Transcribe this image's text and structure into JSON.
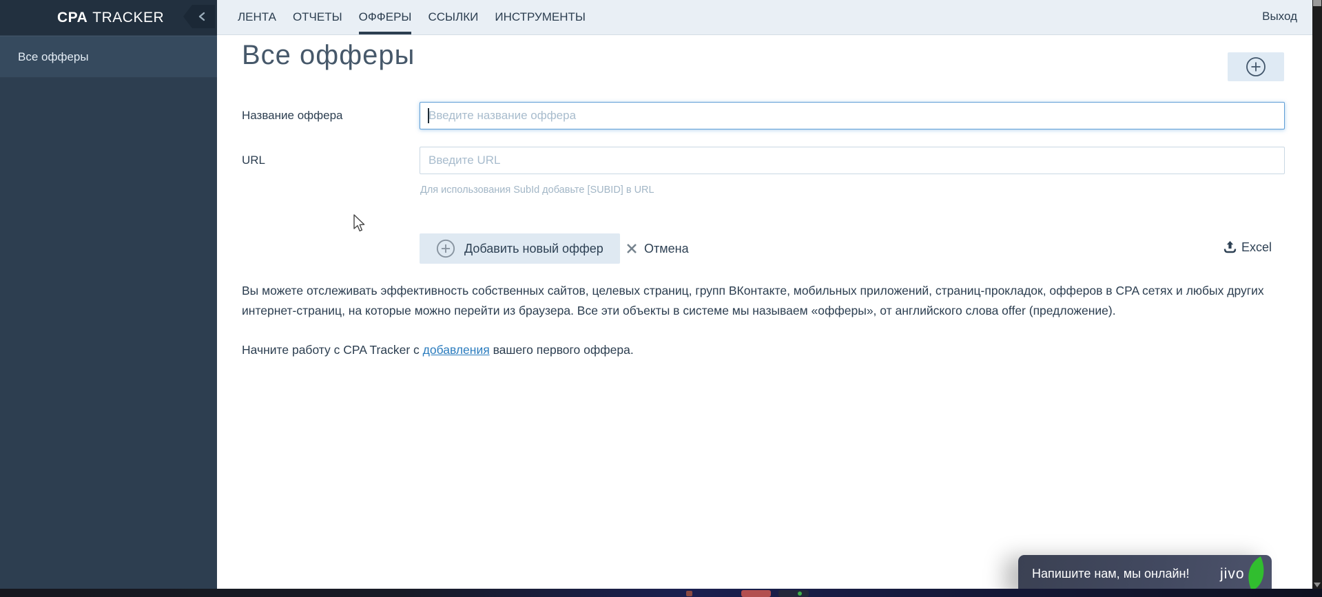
{
  "app": {
    "brand_bold": "CPA",
    "brand_rest": "TRACKER"
  },
  "sidebar": {
    "items": [
      {
        "label": "Все офферы",
        "active": true
      }
    ]
  },
  "nav": {
    "tabs": [
      {
        "label": "ЛЕНТА",
        "active": false
      },
      {
        "label": "ОТЧЕТЫ",
        "active": false
      },
      {
        "label": "ОФФЕРЫ",
        "active": true
      },
      {
        "label": "ССЫЛКИ",
        "active": false
      },
      {
        "label": "ИНСТРУМЕНТЫ",
        "active": false
      }
    ],
    "logout_label": "Выход"
  },
  "main": {
    "title": "Все офферы",
    "form": {
      "name_label": "Название оффера",
      "name_value": "",
      "name_placeholder": "Введите название оффера",
      "url_label": "URL",
      "url_value": "",
      "url_placeholder": "Введите URL",
      "url_hint": "Для использования SubId добавьте [SUBID] в URL",
      "submit_label": "Добавить новый оффер",
      "cancel_label": "Отмена",
      "excel_label": "Excel"
    },
    "description_p1": "Вы можете отслеживать эффективность собственных сайтов, целевых страниц, групп ВКонтакте, мобильных приложений, страниц-прокладок, офферов в CPA сетях и любых других интернет-страниц, на которые можно перейти из браузера. Все эти объекты в системе мы называем «офферы», от английского слова offer (предложение).",
    "description_p2_prefix": "Начните работу с CPA Tracker с ",
    "description_p2_link": "добавления",
    "description_p2_suffix": " вашего первого оффера."
  },
  "chat": {
    "message": "Напишите нам, мы онлайн!",
    "brand": "jivo"
  },
  "icons": {
    "collapse": "chevron-left-icon",
    "add": "circle-plus-icon",
    "cancel": "x-icon",
    "excel": "upload-icon",
    "chat_leaf": "leaf-icon"
  },
  "colors": {
    "sidebar_bg": "#2d3e50",
    "sidebar_header_bg": "#22303f",
    "sidebar_active_bg": "#364a5e",
    "nav_bg": "#e9eff5",
    "accent_dark": "#2c3e50",
    "button_bg": "#dfe9f2",
    "focus_border": "#5e9ed6",
    "link": "#2b7cbe",
    "hint": "#a2b6c6",
    "chat_bg": "#424960",
    "chat_green": "#31be2f"
  }
}
